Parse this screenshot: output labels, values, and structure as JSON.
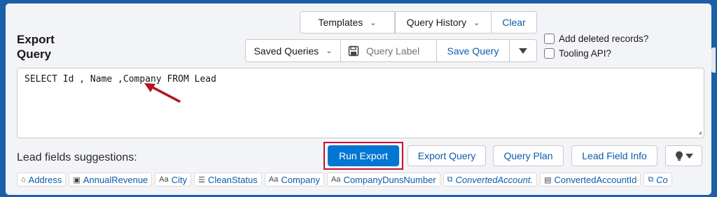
{
  "title_line1": "Export",
  "title_line2": "Query",
  "toolbar": {
    "templates": "Templates",
    "query_history": "Query History",
    "clear": "Clear",
    "saved_queries": "Saved Queries",
    "query_label_placeholder": "Query Label",
    "save_query": "Save Query"
  },
  "options": {
    "add_deleted": "Add deleted records?",
    "tooling_api": "Tooling API?"
  },
  "query_text": "SELECT Id , Name ,Company FROM Lead",
  "suggestions_label": "Lead fields suggestions:",
  "actions": {
    "run_export": "Run Export",
    "export_query": "Export Query",
    "query_plan": "Query Plan",
    "lead_field_info": "Lead Field Info"
  },
  "chips": [
    {
      "label": "Address",
      "icon": "home-icon",
      "glyph": "⌂",
      "italic": false
    },
    {
      "label": "AnnualRevenue",
      "icon": "currency-icon",
      "glyph": "▣",
      "italic": false
    },
    {
      "label": "City",
      "icon": "text-type-icon",
      "glyph": "Aa",
      "italic": false
    },
    {
      "label": "CleanStatus",
      "icon": "list-icon",
      "glyph": "☰",
      "italic": false
    },
    {
      "label": "Company",
      "icon": "text-type-icon",
      "glyph": "Aa",
      "italic": false
    },
    {
      "label": "CompanyDunsNumber",
      "icon": "text-type-icon",
      "glyph": "Aa",
      "italic": false
    },
    {
      "label": "ConvertedAccount.",
      "icon": "reference-icon",
      "glyph": "⧉",
      "italic": true
    },
    {
      "label": "ConvertedAccountId",
      "icon": "id-icon",
      "glyph": "▤",
      "italic": false
    },
    {
      "label": "Co",
      "icon": "reference-icon",
      "glyph": "⧉",
      "italic": true
    }
  ],
  "colors": {
    "background": "#1a5fa8",
    "brand_button": "#0176d3",
    "highlight": "#c8102e",
    "link": "#0b5cab"
  }
}
